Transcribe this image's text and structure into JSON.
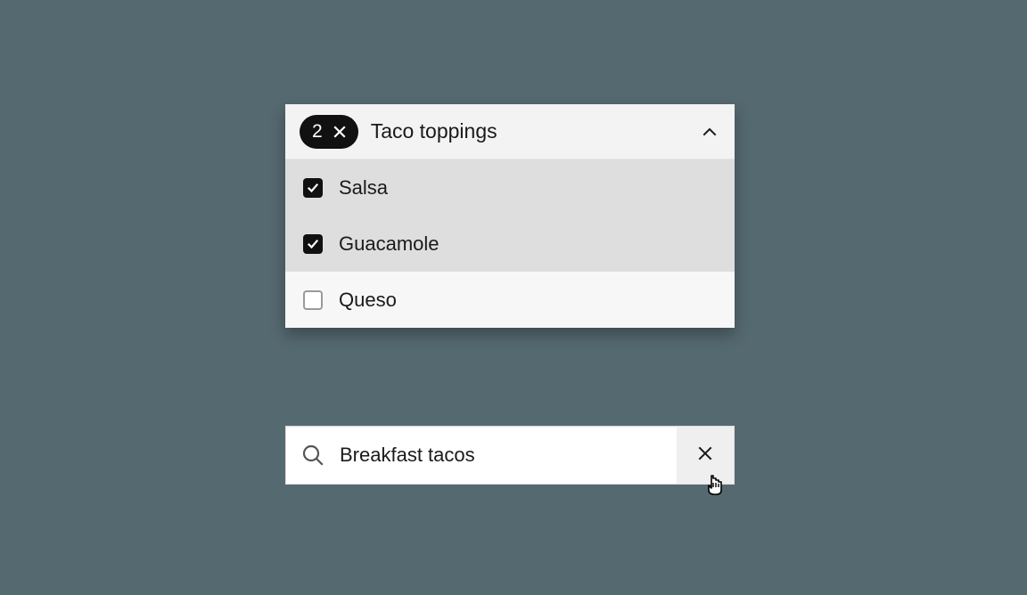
{
  "multiselect": {
    "count": "2",
    "label": "Taco toppings",
    "options": [
      {
        "label": "Salsa",
        "checked": true
      },
      {
        "label": "Guacamole",
        "checked": true
      },
      {
        "label": "Queso",
        "checked": false
      }
    ]
  },
  "search": {
    "value": "Breakfast tacos"
  }
}
